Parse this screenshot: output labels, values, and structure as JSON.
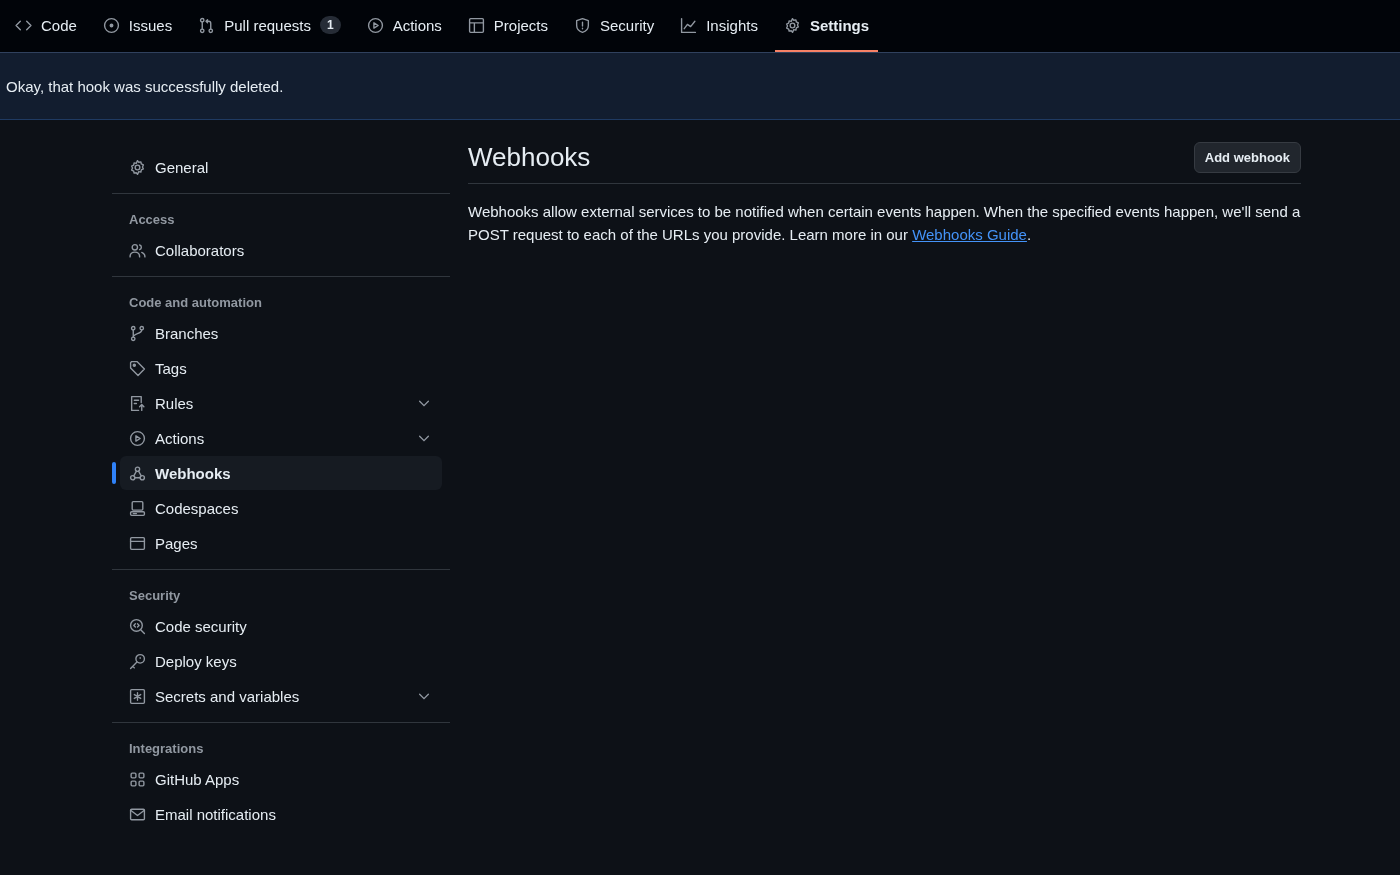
{
  "tabs": [
    {
      "label": "Code",
      "selected": false
    },
    {
      "label": "Issues",
      "selected": false
    },
    {
      "label": "Pull requests",
      "selected": false,
      "counter": "1"
    },
    {
      "label": "Actions",
      "selected": false
    },
    {
      "label": "Projects",
      "selected": false
    },
    {
      "label": "Security",
      "selected": false
    },
    {
      "label": "Insights",
      "selected": false
    },
    {
      "label": "Settings",
      "selected": true
    }
  ],
  "flash": {
    "message": "Okay, that hook was successfully deleted."
  },
  "sidebar": {
    "sections": [
      {
        "items": [
          {
            "label": "General",
            "selected": false,
            "expandable": false
          }
        ]
      },
      {
        "heading": "Access",
        "items": [
          {
            "label": "Collaborators",
            "selected": false,
            "expandable": false
          }
        ]
      },
      {
        "heading": "Code and automation",
        "items": [
          {
            "label": "Branches",
            "selected": false,
            "expandable": false
          },
          {
            "label": "Tags",
            "selected": false,
            "expandable": false
          },
          {
            "label": "Rules",
            "selected": false,
            "expandable": true
          },
          {
            "label": "Actions",
            "selected": false,
            "expandable": true
          },
          {
            "label": "Webhooks",
            "selected": true,
            "expandable": false
          },
          {
            "label": "Codespaces",
            "selected": false,
            "expandable": false
          },
          {
            "label": "Pages",
            "selected": false,
            "expandable": false
          }
        ]
      },
      {
        "heading": "Security",
        "items": [
          {
            "label": "Code security",
            "selected": false,
            "expandable": false
          },
          {
            "label": "Deploy keys",
            "selected": false,
            "expandable": false
          },
          {
            "label": "Secrets and variables",
            "selected": false,
            "expandable": true
          }
        ]
      },
      {
        "heading": "Integrations",
        "items": [
          {
            "label": "GitHub Apps",
            "selected": false,
            "expandable": false
          },
          {
            "label": "Email notifications",
            "selected": false,
            "expandable": false
          }
        ]
      }
    ]
  },
  "content": {
    "title": "Webhooks",
    "button": "Add webhook",
    "description": {
      "text": "Webhooks allow external services to be notified when certain events happen. When the specified events happen, we'll send a POST request to each of the URLs you provide. Learn more in our ",
      "link": "Webhooks Guide",
      "end": "."
    }
  }
}
